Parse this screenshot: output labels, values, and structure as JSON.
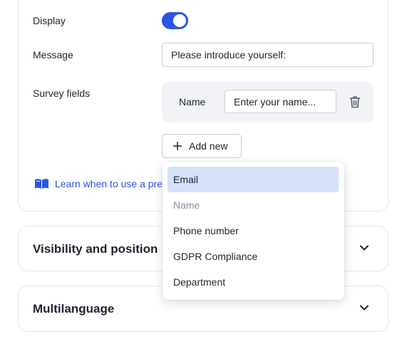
{
  "settings": {
    "display_label": "Display",
    "display_enabled": true,
    "message_label": "Message",
    "message_value": "Please introduce yourself:",
    "survey_fields_label": "Survey fields",
    "fields": [
      {
        "label": "Name",
        "placeholder": "Enter your name..."
      }
    ],
    "add_new_label": "Add new",
    "learn_link_text": "Learn when to use a pre"
  },
  "dropdown": {
    "options": [
      "Email",
      "Name",
      "Phone number",
      "GDPR Compliance",
      "Department"
    ],
    "selected": "Email",
    "disabled": [
      "Name"
    ]
  },
  "sections": {
    "visibility_title": "Visibility and position",
    "multilanguage_title": "Multilanguage"
  },
  "colors": {
    "accent": "#2a55e5",
    "selected_bg": "#d6e0fb"
  },
  "icons": [
    "book-icon",
    "plus-icon",
    "trash-icon",
    "chevron-down-icon"
  ]
}
